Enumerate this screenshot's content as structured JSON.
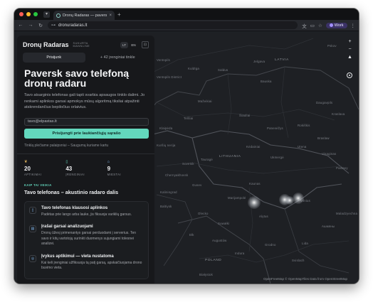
{
  "browser": {
    "tab_title": "Dronų Radaras — paversk sav...",
    "tab_close": "×",
    "new_tab": "+",
    "url": "dronuradaras.lt",
    "profile_label": "Work",
    "icons": {
      "tab_list": "▾",
      "back": "←",
      "forward": "→",
      "reload": "↻",
      "site_info": "⊶",
      "translate": "文",
      "cast": "▭",
      "bookmark": "☆",
      "menu": "⋮"
    }
  },
  "map": {
    "attribution": "OpenFreeMap © OpenMapTiles Data from OpenStreetMap",
    "controls": {
      "zoom_in": "+",
      "zoom_out": "−",
      "compass": "▲"
    },
    "labels": {
      "latvia": "LATVIA",
      "lithuania": "LITHUANIA",
      "poland": "POLAND",
      "l1": "Ventspils",
      "l2": "Kuldīga",
      "l3": "Saldus",
      "l4": "Jelgava",
      "l5": "Bauska",
      "l6": "Daugavpils",
      "l7": "Šiauliai",
      "l8": "Panevėžys",
      "l9": "Mažeikiai",
      "l10": "Telšiai",
      "l11": "Rokiškis",
      "l12": "Utena",
      "l13": "Ukmergė",
      "l14": "Kėdainiai",
      "l15": "Kaunas",
      "l16": "Vilnius",
      "l17": "Klaipėda",
      "l18": "Tauragė",
      "l19": "Marijampolė",
      "l20": "Alytus",
      "l21": "Sovetsk",
      "l22": "Gusev",
      "l23": "Suwałki",
      "l24": "Ełk",
      "l25": "Olecko",
      "l26": "Grodno",
      "l27": "Lida",
      "l28": "Ашмяны",
      "l29": "Maladzyechna",
      "l30": "Augustów",
      "l31": "Pastavy",
      "l32": "Ventspils District",
      "l33": "Kuršių nerija",
      "l34": "Białystok",
      "l35": "Indura",
      "l36": "Svislach",
      "l37": "Chernyakhovsk",
      "l38": "Kaliningrad",
      "l39": "Baltiysk",
      "l40": "Pskov",
      "l41": "Kraslava",
      "l42": "Braslaw",
      "l43": "Visaginas"
    }
  },
  "panel": {
    "brand": "Dronų Radaras",
    "brand_sub": "SUKURTA MANNLINE",
    "lang_lt": "LT",
    "lang_en": "EN",
    "settings_icon": "⊡",
    "tab_join": "Prisijunk",
    "tab_network": "+ 42 įrenginiai tinkle",
    "hero": "Paversk savo telefoną dronų radaru",
    "description": "Tavo atsarginis telefonas gali tapti svarbia apsaugos tinklo dalimi. Jo renkami aplinkos garsai apmokys mūsų algoritmą tiksliai atpažinti atskrendančius bepiločius orlaivius.",
    "email_value": "tavo@elpastas.lt",
    "cta": "Prisijungti prie laukiančiųjų sąrašo",
    "note": "Tinklą plečiame palaipsniui – Saugumą kuriame kartu",
    "stats": [
      {
        "icon": "❦",
        "value": "20",
        "label": "APTIKIMAI"
      },
      {
        "icon": "▯",
        "value": "43",
        "label": "ĮRENGINIAI"
      },
      {
        "icon": "⌂",
        "value": "9",
        "label": "MIESTAI"
      }
    ],
    "how_kicker": "KAIP TAI VEIKIA",
    "how_title": "Tavo telefonas – akustinio radaro dalis",
    "steps": [
      {
        "icon": "▯",
        "title": "Tavo telefonas klausosi aplinkos",
        "desc": "Padėtas prie lango arba lauke, jis fiksuoja variklių garsus."
      },
      {
        "icon": "▤",
        "title": "Įrašai garsai analizuojami",
        "desc": "Dronų ūžesį primenantys garsai perduodami į serverius. Ten savo ir kitų vartotojų surinkti duomenys sujungiami tolesnei analizei."
      },
      {
        "icon": "◎",
        "title": "Įvykus aptikimui — vieta nustatoma",
        "desc": "Kai keli įrenginiai užfiksuoja tą patį garsą, apskaičiuojama drono buvimo vieta."
      }
    ]
  }
}
